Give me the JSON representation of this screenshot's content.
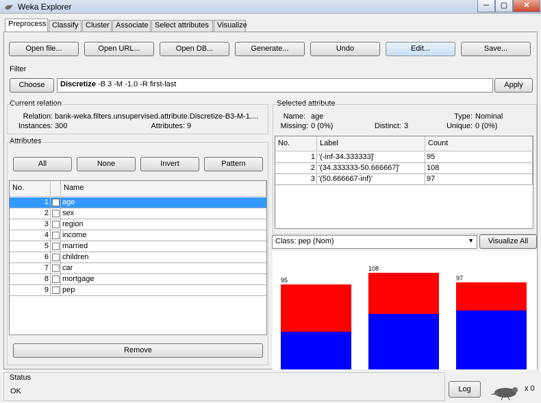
{
  "window": {
    "title": "Weka Explorer",
    "controls": [
      "─",
      "▢",
      "✕"
    ]
  },
  "tabs": [
    "Preprocess",
    "Classify",
    "Cluster",
    "Associate",
    "Select attributes",
    "Visualize"
  ],
  "toolbar": [
    "Open file...",
    "Open URL...",
    "Open DB...",
    "Generate...",
    "Undo",
    "Edit...",
    "Save..."
  ],
  "filter": {
    "section": "Filter",
    "choose": "Choose",
    "name": "Discretize",
    "args": " -B 3 -M -1.0 -R first-last",
    "apply": "Apply"
  },
  "current_relation": {
    "section": "Current relation",
    "relation_label": "Relation:",
    "relation_value": "bank-weka.filters.unsupervised.attribute.Discretize-B3-M-1....",
    "instances_label": "Instances:",
    "instances_value": "300",
    "attributes_label": "Attributes:",
    "attributes_value": "9"
  },
  "attributes": {
    "section": "Attributes",
    "buttons": [
      "All",
      "None",
      "Invert",
      "Pattern"
    ],
    "headers": [
      "No.",
      "",
      "Name"
    ],
    "rows": [
      {
        "no": "1",
        "name": "age"
      },
      {
        "no": "2",
        "name": "sex"
      },
      {
        "no": "3",
        "name": "region"
      },
      {
        "no": "4",
        "name": "income"
      },
      {
        "no": "5",
        "name": "married"
      },
      {
        "no": "6",
        "name": "children"
      },
      {
        "no": "7",
        "name": "car"
      },
      {
        "no": "8",
        "name": "mortgage"
      },
      {
        "no": "9",
        "name": "pep"
      }
    ],
    "remove": "Remove"
  },
  "selected_attribute": {
    "section": "Selected attribute",
    "name_label": "Name:",
    "name_value": "age",
    "type_label": "Type:",
    "type_value": "Nominal",
    "missing_label": "Missing:",
    "missing_value": "0 (0%)",
    "distinct_label": "Distinct:",
    "distinct_value": "3",
    "unique_label": "Unique:",
    "unique_value": "0 (0%)",
    "headers": [
      "No.",
      "Label",
      "Count"
    ],
    "rows": [
      {
        "no": "1",
        "label": "'(-inf-34.333333]'",
        "count": "95"
      },
      {
        "no": "2",
        "label": "'(34.333333-50.666667]'",
        "count": "108"
      },
      {
        "no": "3",
        "label": "'(50.666667-inf)'",
        "count": "97"
      }
    ]
  },
  "class_select": {
    "value": "Class: pep (Nom)",
    "visualize_all": "Visualize All"
  },
  "chart_data": {
    "type": "bar",
    "stacked": true,
    "categories": [
      "'(-inf-34.333333]'",
      "'(34.333333-50.666667]'",
      "'(50.666667-inf)'"
    ],
    "totals": [
      95,
      108,
      97
    ],
    "colors": [
      "#0000ff",
      "#ff0000"
    ],
    "series": [
      {
        "values": [
          42,
          62,
          66
        ]
      },
      {
        "values": [
          53,
          46,
          31
        ]
      }
    ]
  },
  "status": {
    "section": "Status",
    "text": "OK",
    "log": "Log",
    "count": "x 0"
  }
}
